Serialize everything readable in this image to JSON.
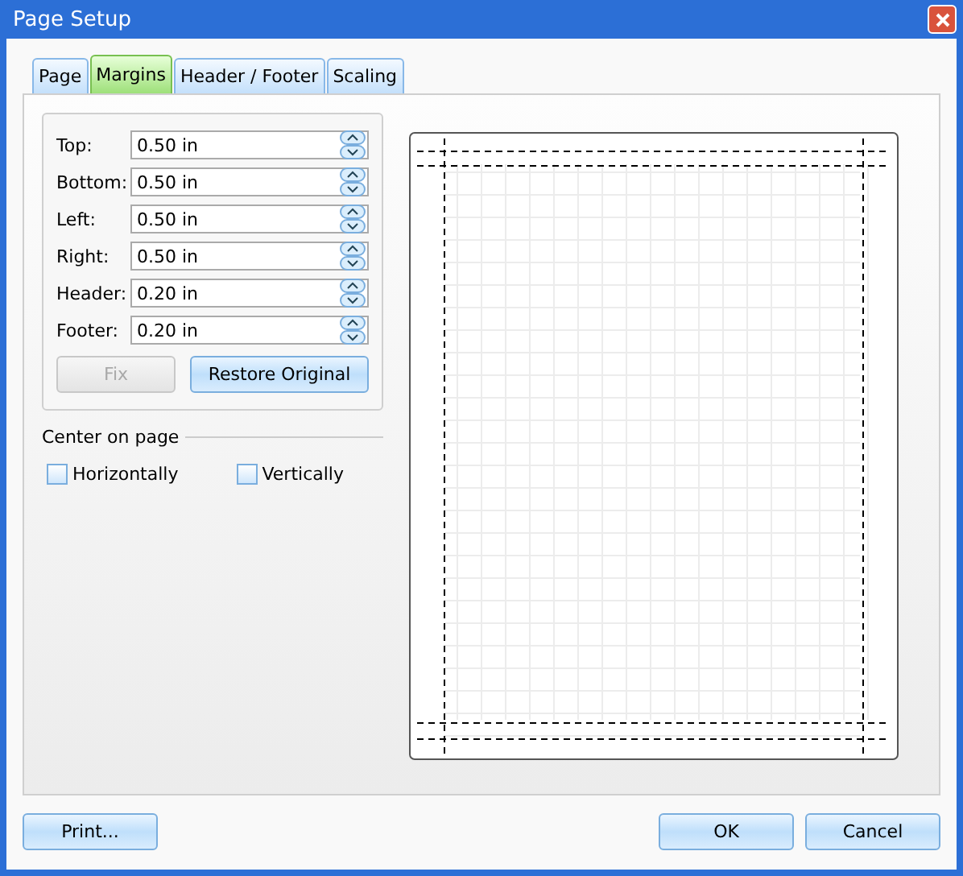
{
  "window": {
    "title": "Page Setup"
  },
  "tabs": [
    {
      "label": "Page",
      "selected": false
    },
    {
      "label": "Margins",
      "selected": true
    },
    {
      "label": "Header / Footer",
      "selected": false
    },
    {
      "label": "Scaling",
      "selected": false
    }
  ],
  "margins": [
    {
      "label": "Top:",
      "value": "0.50 in"
    },
    {
      "label": "Bottom:",
      "value": "0.50 in"
    },
    {
      "label": "Left:",
      "value": "0.50 in"
    },
    {
      "label": "Right:",
      "value": "0.50 in"
    },
    {
      "label": "Header:",
      "value": "0.20 in"
    },
    {
      "label": "Footer:",
      "value": "0.20 in"
    }
  ],
  "margin_buttons": [
    {
      "label": "Fix",
      "disabled": true
    },
    {
      "label": "Restore Original",
      "disabled": false
    }
  ],
  "center_on_page": {
    "title": "Center on page",
    "options": [
      {
        "label": "Horizontally",
        "checked": false
      },
      {
        "label": "Vertically",
        "checked": false
      }
    ]
  },
  "footer_buttons": {
    "left": [
      "Print..."
    ],
    "right": [
      "OK",
      "Cancel"
    ]
  }
}
